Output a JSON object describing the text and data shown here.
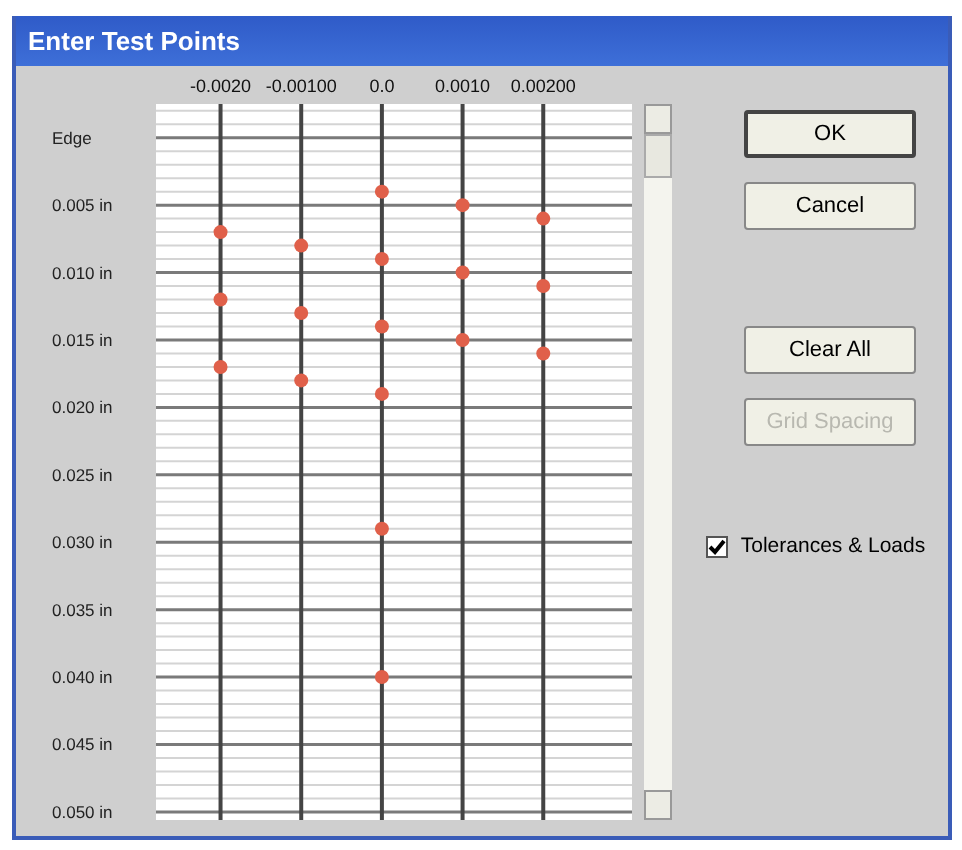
{
  "window": {
    "title": "Enter Test Points"
  },
  "grid": {
    "chart_data": {
      "type": "scatter",
      "xlim": [
        -0.0028,
        0.0031
      ],
      "ylim": [
        0.0506,
        -0.0025
      ],
      "xticks": [
        {
          "value": -0.002,
          "label": "-0.0020"
        },
        {
          "value": -0.001,
          "label": "-0.00100"
        },
        {
          "value": 0,
          "label": "0.0"
        },
        {
          "value": 0.001,
          "label": "0.0010"
        },
        {
          "value": 0.002,
          "label": "0.00200"
        }
      ],
      "yticks": [
        {
          "value": 0,
          "label": "Edge"
        },
        {
          "value": 0.005,
          "label": "0.005 in"
        },
        {
          "value": 0.01,
          "label": "0.010 in"
        },
        {
          "value": 0.015,
          "label": "0.015 in"
        },
        {
          "value": 0.02,
          "label": "0.020 in"
        },
        {
          "value": 0.025,
          "label": "0.025 in"
        },
        {
          "value": 0.03,
          "label": "0.030 in"
        },
        {
          "value": 0.035,
          "label": "0.035 in"
        },
        {
          "value": 0.04,
          "label": "0.040 in"
        },
        {
          "value": 0.045,
          "label": "0.045 in"
        },
        {
          "value": 0.05,
          "label": "0.050 in"
        }
      ],
      "grid": true,
      "series": [
        {
          "color": "#e0604a",
          "x": [
            -0.002,
            -0.002,
            -0.002,
            -0.001,
            -0.001,
            -0.001,
            0,
            0,
            0,
            0,
            0,
            0,
            0.001,
            0.001,
            0.001,
            0.002,
            0.002,
            0.002
          ],
          "values": [
            0.007,
            0.012,
            0.017,
            0.008,
            0.013,
            0.018,
            0.004,
            0.009,
            0.014,
            0.019,
            0.029,
            0.04,
            0.005,
            0.01,
            0.015,
            0.006,
            0.011,
            0.016
          ]
        }
      ]
    }
  },
  "buttons": [
    {
      "label": "OK",
      "default": true,
      "disabled": false
    },
    {
      "label": "Cancel",
      "default": false,
      "disabled": false
    },
    {
      "label": "Clear All",
      "default": false,
      "disabled": false
    },
    {
      "label": "Grid Spacing",
      "default": false,
      "disabled": true
    }
  ],
  "checkbox": {
    "label": "Tolerances & Loads",
    "checked": true
  }
}
